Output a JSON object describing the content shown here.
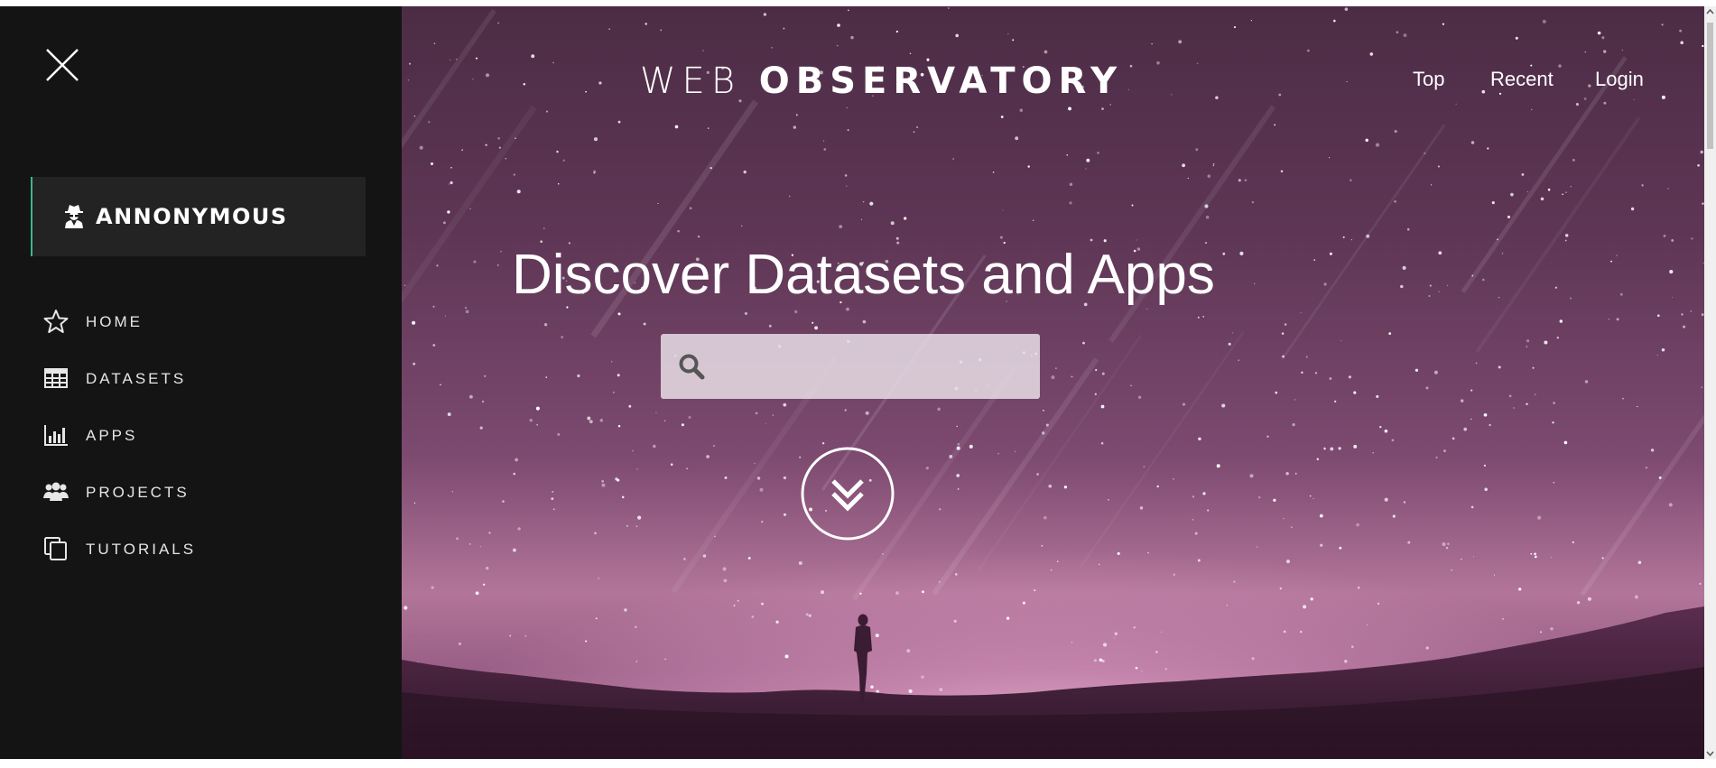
{
  "sidebar": {
    "close_icon": "close-icon",
    "user": {
      "name": "ANNONYMOUS",
      "icon": "user-secret-icon"
    },
    "items": [
      {
        "label": "HOME",
        "icon": "star-icon"
      },
      {
        "label": "DATASETS",
        "icon": "table-icon"
      },
      {
        "label": "APPS",
        "icon": "bar-chart-icon"
      },
      {
        "label": "PROJECTS",
        "icon": "users-icon"
      },
      {
        "label": "TUTORIALS",
        "icon": "copy-icon"
      }
    ],
    "accent": "#3fb58a",
    "background": "#141414"
  },
  "header": {
    "brand_light": "WEB",
    "brand_bold": "OBSERVATORY",
    "nav": [
      {
        "label": "Top"
      },
      {
        "label": "Recent"
      },
      {
        "label": "Login"
      }
    ]
  },
  "hero": {
    "headline": "Discover Datasets and Apps",
    "search": {
      "placeholder": "",
      "value": "",
      "icon": "search-icon"
    },
    "scroll_icon": "double-chevron-down-icon"
  }
}
